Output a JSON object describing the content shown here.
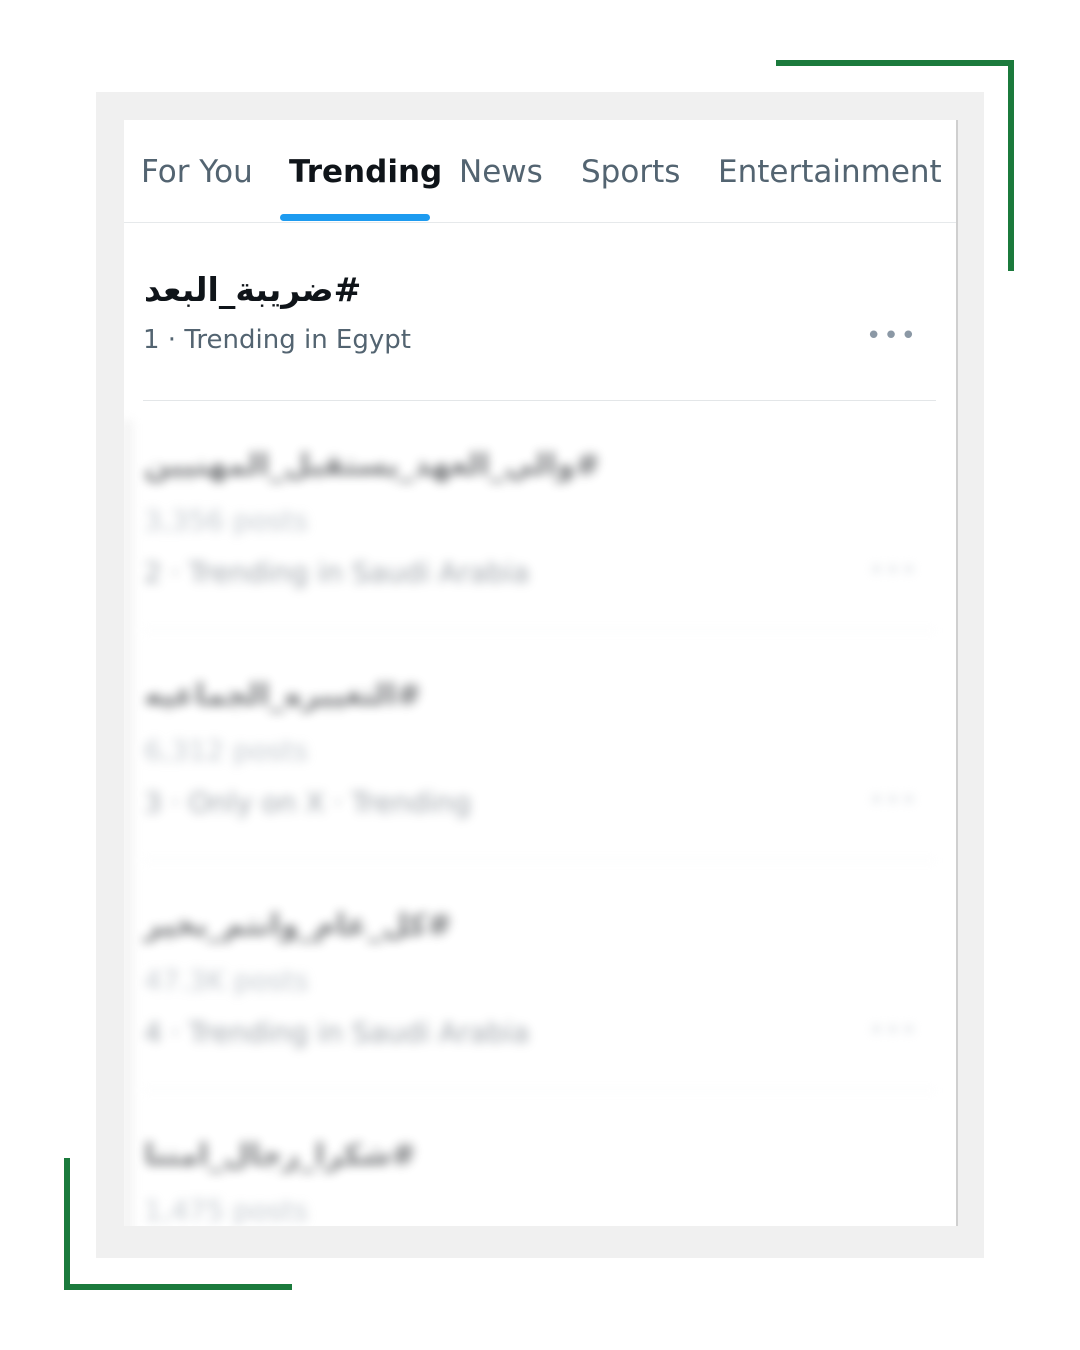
{
  "tabs": [
    {
      "label": "For You",
      "active": false
    },
    {
      "label": "Trending",
      "active": true
    },
    {
      "label": "News",
      "active": false
    },
    {
      "label": "Sports",
      "active": false
    },
    {
      "label": "Entertainment",
      "active": false
    }
  ],
  "top_trend": {
    "name": "#ضريبة_البعد",
    "meta": "1 · Trending in Egypt",
    "more": "•••"
  },
  "blurred_trends": [
    {
      "name": "#والي_العهد_يستقبل_المهنيين",
      "posts": "3,356 posts",
      "meta": "2 · Trending in Saudi Arabia",
      "more": "•••"
    },
    {
      "name": "#التغييره_الجماعيه",
      "posts": "6,312 posts",
      "meta": "3 · Only on X · Trending",
      "more": "•••"
    },
    {
      "name": "#كل_عام_وانتم_بخير",
      "posts": "47.3K posts",
      "meta": "4 · Trending in Saudi Arabia",
      "more": "•••"
    },
    {
      "name": "#شكرا_رجال_امننا",
      "posts": "1,475 posts",
      "meta": "",
      "more": ""
    }
  ],
  "colors": {
    "accent_blue": "#1d9bf0",
    "frame_green": "#1b7a3c",
    "text_primary": "#0f1419",
    "text_secondary": "#536471"
  }
}
